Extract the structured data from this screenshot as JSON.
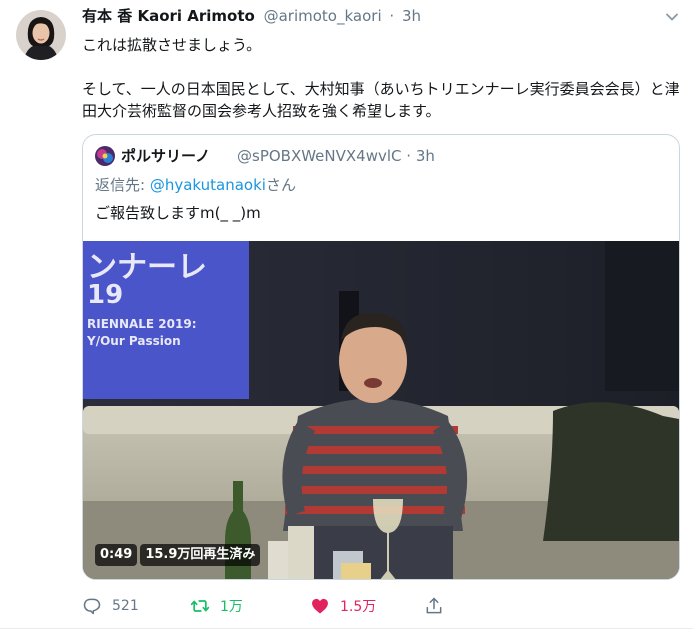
{
  "tweet": {
    "display_name": "有本 香 Kaori Arimoto",
    "handle": "@arimoto_kaori",
    "separator": "·",
    "time": "3h",
    "text_line1": "これは拡散させましょう。",
    "text_para2": "そして、一人の日本国民として、大村知事（あいちトリエンナーレ実行委員会会長）と津田大介芸術監督の国会参考人招致を強く希望します。"
  },
  "quoted": {
    "display_name": "ポルサリーノ",
    "handle": "@sPOBXWeNVX4wvlC",
    "separator": "·",
    "time": "3h",
    "reply_prefix": "返信先: ",
    "reply_mention": "@hyakutanaoki",
    "reply_suffix": "さん",
    "text": "ご報告致しますm(_ _)m",
    "video": {
      "duration": "0:49",
      "views": "15.9万回再生済み",
      "screen_line1": "ンナーレ",
      "screen_line2": "19",
      "screen_line3": "RIENNALE 2019:",
      "screen_line4": "Y/Our Passion"
    }
  },
  "actions": {
    "reply_count": "521",
    "retweet_count": "1万",
    "like_count": "1.5万"
  },
  "colors": {
    "accent": "#1b95e0",
    "retweet": "#17bf63",
    "like": "#e0245e",
    "secondary_text": "#657786"
  },
  "icons": [
    "reply-icon",
    "retweet-icon",
    "heart-icon",
    "share-icon",
    "caret-down-icon"
  ]
}
